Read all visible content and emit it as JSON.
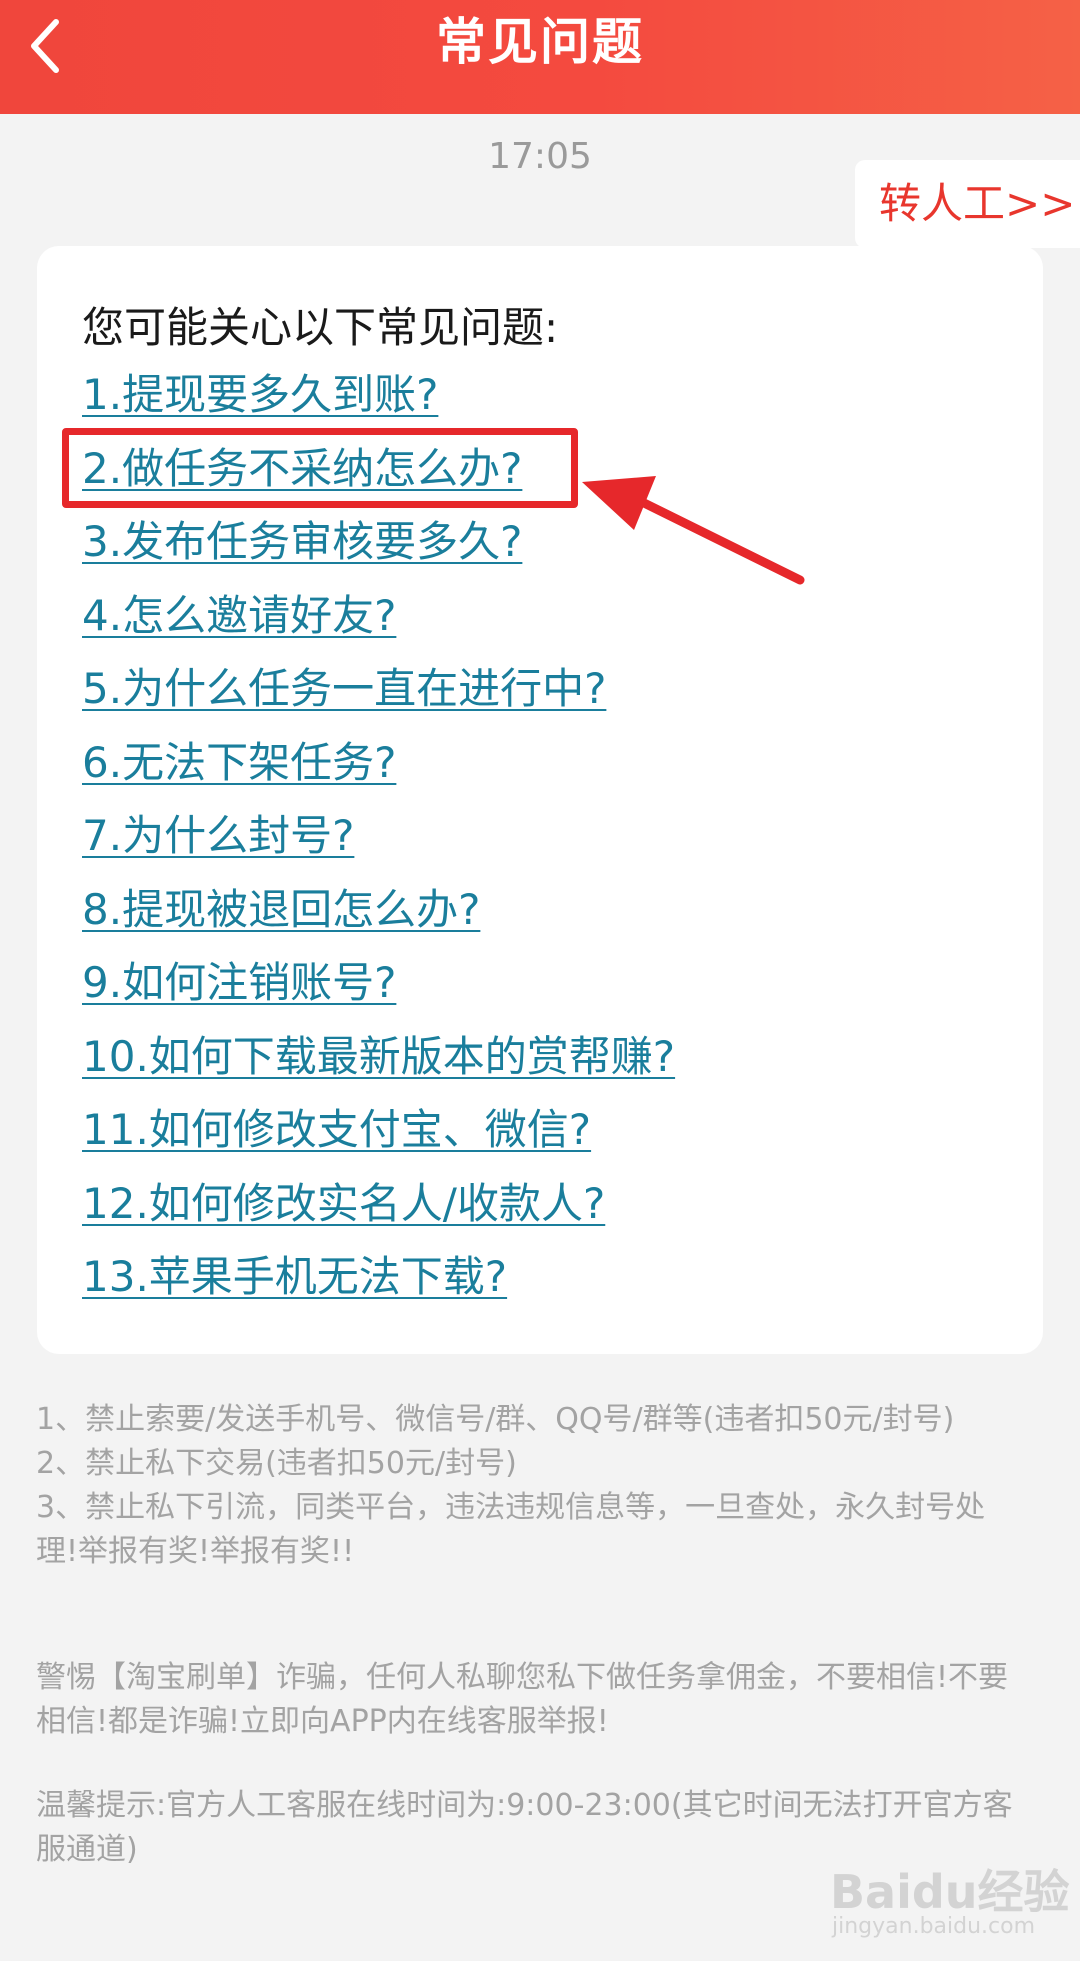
{
  "header": {
    "title": "常见问题",
    "back_icon": "chevron-left-icon",
    "bg_color": "#f44a3f"
  },
  "chat": {
    "timestamp": "17:05",
    "transfer_button": "转人工>>"
  },
  "faq": {
    "heading": "您可能关心以下常见问题:",
    "link_color": "#1a7e9c",
    "items": [
      "1.提现要多久到账? ",
      "2.做任务不采纳怎么办?",
      "3.发布任务审核要多久? ",
      "4.怎么邀请好友? ",
      "5.为什么任务一直在进行中? ",
      "6.无法下架任务? ",
      "7.为什么封号? ",
      "8.提现被退回怎么办? ",
      "9.如何注销账号? ",
      "10.如何下载最新版本的赏帮赚? ",
      "11.如何修改支付宝、微信? ",
      "12.如何修改实名人/收款人? ",
      "13.苹果手机无法下载? "
    ]
  },
  "annotation": {
    "highlight_color": "#e6282b"
  },
  "notices": {
    "rules": [
      "1、禁止索要/发送手机号、微信号/群、QQ号/群等(违者扣50元/封号)",
      "2、禁止私下交易(违者扣50元/封号)",
      "3、禁止私下引流，同类平台，违法违规信息等，一旦查处，永久封号处理!举报有奖!举报有奖!!"
    ],
    "fraud_warning": "警惕【淘宝刷单】诈骗，任何人私聊您私下做任务拿佣金，不要相信!不要相信!都是诈骗!立即向APP内在线客服举报!",
    "service_hours": "温馨提示:官方人工客服在线时间为:9:00-23:00(其它时间无法打开官方客服通道)"
  },
  "watermark": {
    "logo": "Baidu经验",
    "url": "jingyan.baidu.com"
  }
}
